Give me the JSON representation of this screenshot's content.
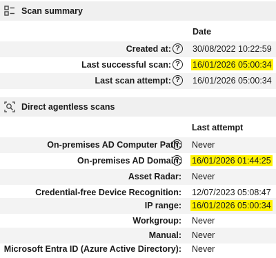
{
  "scan_summary": {
    "title": "Scan summary",
    "column_header": "Date",
    "rows": [
      {
        "label": "Created at:",
        "value": "30/08/2022 10:22:59",
        "highlight": false
      },
      {
        "label": "Last successful scan:",
        "value": "16/01/2026 05:00:34",
        "highlight": true
      },
      {
        "label": "Last scan attempt:",
        "value": "16/01/2026 05:00:34",
        "highlight": false
      }
    ]
  },
  "agentless": {
    "title": "Direct agentless scans",
    "column_header": "Last attempt",
    "rows": [
      {
        "label": "On-premises AD Computer Path:",
        "value": "Never",
        "highlight": false
      },
      {
        "label": "On-premises AD Domain:",
        "value": "16/01/2026 01:44:25",
        "highlight": true
      },
      {
        "label": "Asset Radar:",
        "value": "Never",
        "highlight": false
      },
      {
        "label": "Credential-free Device Recognition:",
        "value": "12/07/2023 05:08:47",
        "highlight": false
      },
      {
        "label": "IP range:",
        "value": "16/01/2026 05:00:34",
        "highlight": true
      },
      {
        "label": "Workgroup:",
        "value": "Never",
        "highlight": false
      },
      {
        "label": "Manual:",
        "value": "Never",
        "highlight": false
      },
      {
        "label": "Microsoft Entra ID (Azure Active Directory):",
        "value": "Never",
        "highlight": false
      }
    ]
  },
  "help_glyph": "?",
  "highlight_color": "#fff200"
}
